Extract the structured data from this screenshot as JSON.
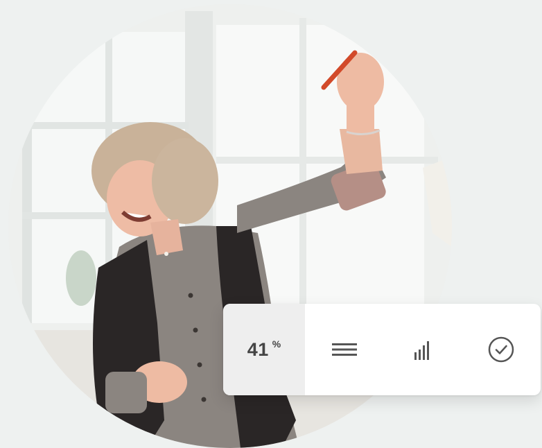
{
  "photo": {
    "alt_subject": "woman-celebrating-photo"
  },
  "toolbar": {
    "percent_value": "41",
    "percent_unit": "%",
    "icons": [
      "menu-lines-icon",
      "bar-chart-icon",
      "check-circle-icon"
    ]
  },
  "colors": {
    "background": "#eef1f0",
    "toolbar_bg": "#ffffff",
    "percent_cell_bg": "#eeeeee",
    "icon_color": "#555555"
  }
}
